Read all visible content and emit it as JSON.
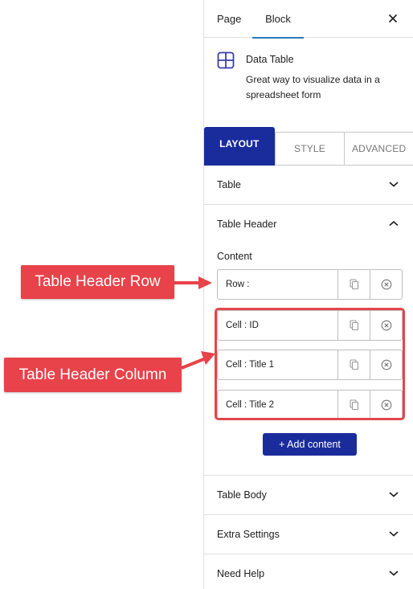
{
  "sidebar": {
    "tabs": [
      {
        "label": "Page",
        "active": false
      },
      {
        "label": "Block",
        "active": true
      }
    ],
    "close_icon": "close-icon",
    "block": {
      "icon": "table-grid-icon",
      "title": "Data Table",
      "description": "Great way to visualize data in a spreadsheet form"
    },
    "segments": [
      {
        "label": "LAYOUT",
        "active": true
      },
      {
        "label": "STYLE",
        "active": false
      },
      {
        "label": "ADVANCED",
        "active": false
      }
    ],
    "sections": {
      "table": {
        "label": "Table",
        "expanded": false
      },
      "table_header": {
        "label": "Table Header",
        "expanded": true
      },
      "table_body": {
        "label": "Table Body",
        "expanded": false
      },
      "extra_settings": {
        "label": "Extra Settings",
        "expanded": false
      },
      "need_help": {
        "label": "Need Help",
        "expanded": false
      }
    },
    "table_header": {
      "content_label": "Content",
      "items": [
        {
          "label": "Row :"
        },
        {
          "label": "Cell : ID"
        },
        {
          "label": "Cell : Title 1"
        },
        {
          "label": "Cell : Title 2"
        }
      ],
      "add_button": "+ Add content"
    }
  },
  "annotations": {
    "row_callout": "Table Header Row",
    "column_callout": "Table Header Column",
    "color": "#e8424a"
  },
  "colors": {
    "primary": "#1a2c9c",
    "tab_underline": "#2a7ab8",
    "icon": "#3b3fa8"
  }
}
